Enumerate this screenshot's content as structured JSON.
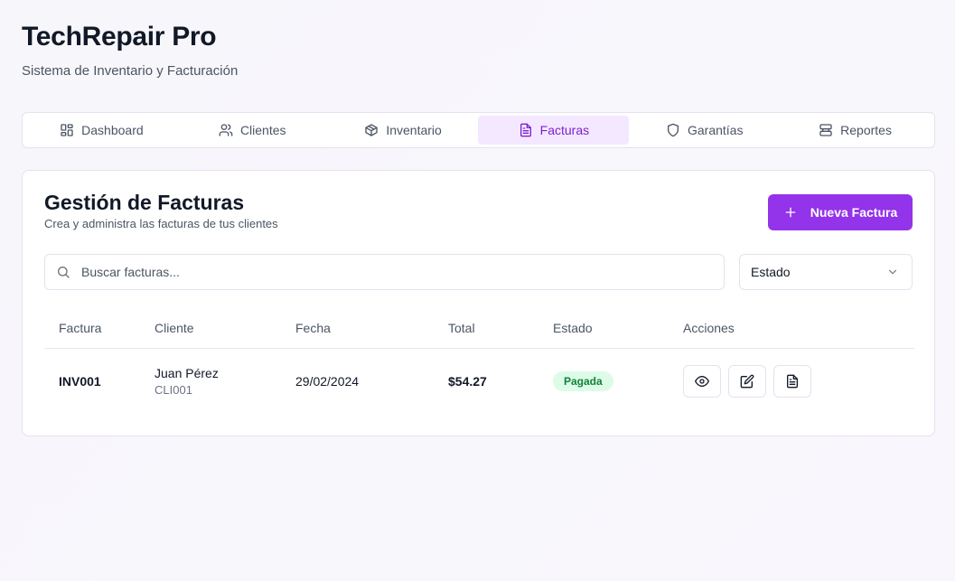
{
  "app": {
    "title": "TechRepair Pro",
    "subtitle": "Sistema de Inventario y Facturación"
  },
  "tabs": [
    {
      "label": "Dashboard",
      "icon": "dashboard-icon"
    },
    {
      "label": "Clientes",
      "icon": "users-icon"
    },
    {
      "label": "Inventario",
      "icon": "package-icon"
    },
    {
      "label": "Facturas",
      "icon": "file-text-icon",
      "active": true
    },
    {
      "label": "Garantías",
      "icon": "shield-icon"
    },
    {
      "label": "Reportes",
      "icon": "server-icon"
    }
  ],
  "invoices": {
    "title": "Gestión de Facturas",
    "subtitle": "Crea y administra las facturas de tus clientes",
    "new_button": "Nueva Factura",
    "search_placeholder": "Buscar facturas...",
    "status_filter": "Estado",
    "columns": [
      "Factura",
      "Cliente",
      "Fecha",
      "Total",
      "Estado",
      "Acciones"
    ],
    "rows": [
      {
        "id": "INV001",
        "client_name": "Juan Pérez",
        "client_id": "CLI001",
        "date": "29/02/2024",
        "total": "$54.27",
        "status": "Pagada",
        "actions": [
          "view-icon",
          "edit-icon",
          "pdf-icon"
        ]
      }
    ]
  },
  "colors": {
    "accent": "#9333ea",
    "tab_active_bg": "#f3e8ff",
    "tab_active_text": "#7e22ce",
    "status_paid_bg": "#dcfce7",
    "status_paid_text": "#15803d"
  }
}
